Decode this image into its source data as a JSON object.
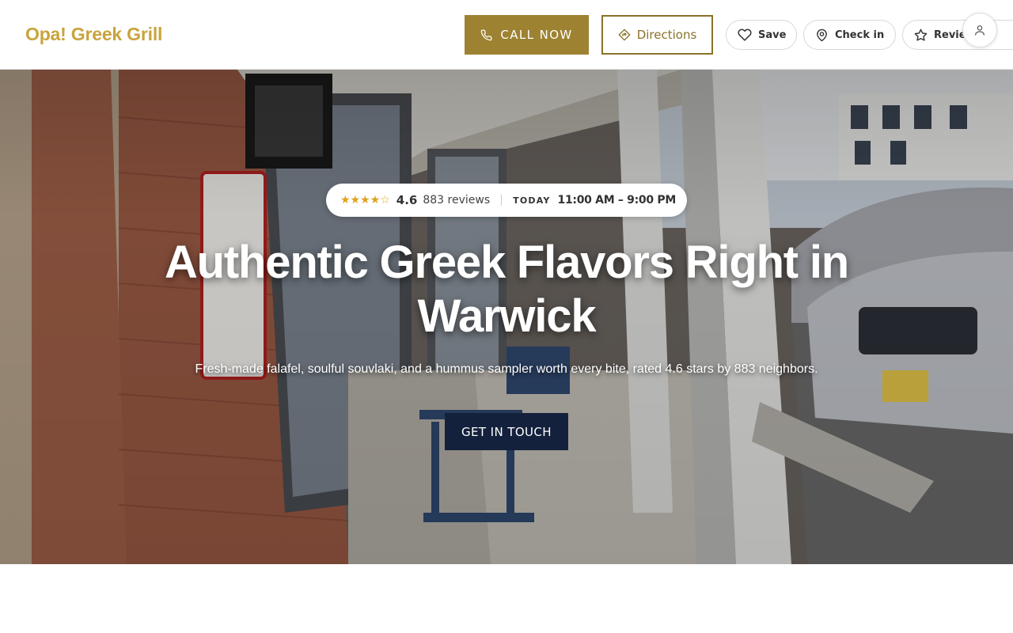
{
  "header": {
    "brand": "Opa! Greek Grill",
    "call_label": "CALL NOW",
    "directions_label": "Directions",
    "save_label": "Save",
    "checkin_label": "Check in",
    "review_label": "Review",
    "icons": {
      "call": "phone-icon",
      "directions": "directions-icon",
      "save": "heart-icon",
      "checkin": "map-pin-icon",
      "review": "star-icon",
      "account": "user-icon"
    }
  },
  "hero": {
    "stars": "★★★★☆",
    "rating_value": 4.6,
    "rating": "4.6",
    "review_count": "883 reviews",
    "today_label": "TODAY",
    "hours": "11:00 AM – 9:00 PM",
    "title": "Authentic Greek Flavors Right in Warwick",
    "subtitle": "Fresh-made falafel, soulful souvlaki, and a hummus sampler worth every bite, rated 4.6 stars by 883 neighbors.",
    "cta_label": "GET IN TOUCH"
  },
  "colors": {
    "brand": "#c9a43c",
    "call_bg": "#9d8232",
    "directions_border": "#8a7229",
    "star": "#e0a21b",
    "cta_bg": "#14213d"
  }
}
